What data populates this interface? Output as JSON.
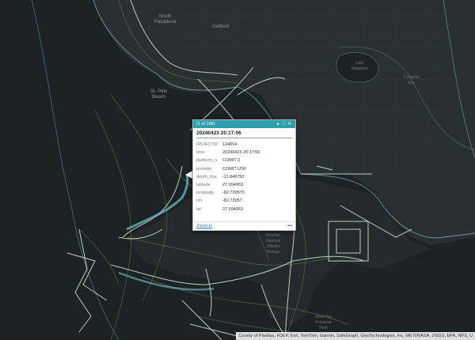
{
  "map": {
    "places": [
      {
        "id": "south-pasadena",
        "label": "South\nPasadena"
      },
      {
        "id": "gulfport",
        "label": "Gulfport"
      },
      {
        "id": "st-pete-beach",
        "label": "St. Pete\nBeach"
      },
      {
        "id": "lake-maggiore",
        "label": "Lake\nMaggiore"
      },
      {
        "id": "coquina-key",
        "label": "Coquina\nKey"
      },
      {
        "id": "pinellas-refuge",
        "label": "Pinellas\nNational\nWildlife\nRefuge"
      },
      {
        "id": "shell-key",
        "label": "Shell Key\nPreserve\nPark"
      }
    ],
    "attribution": "County of Pinellas, FDEP, Esri, TomTom, Garmin, SafeGraph, GeoTechnologies, Inc, METI/NASA, USGS, EPA, NPS, U",
    "colors": {
      "track": "#d8ecd6",
      "track_highlight": "#6fc4d2",
      "contour": "#6b7a3e",
      "shore": "#7fb7c9"
    }
  },
  "popup": {
    "count": "(1 of 188)",
    "title": "20240423 20:17:06",
    "attributes": [
      {
        "key": "OBJECTID",
        "value": "124054"
      },
      {
        "key": "time",
        "value": "20240423 20:17:06"
      },
      {
        "key": "platform_n",
        "value": "COMIT 3"
      },
      {
        "key": "provider",
        "value": "COMIT USF"
      },
      {
        "key": "depth_fina",
        "value": "-11.848750"
      },
      {
        "key": "latitude",
        "value": "27.694063"
      },
      {
        "key": "longitude",
        "value": "-82.730570"
      },
      {
        "key": "lon",
        "value": "-82.73057"
      },
      {
        "key": "lat",
        "value": "27.694063"
      }
    ],
    "zoom_to": "Zoom to",
    "more": "•••"
  }
}
